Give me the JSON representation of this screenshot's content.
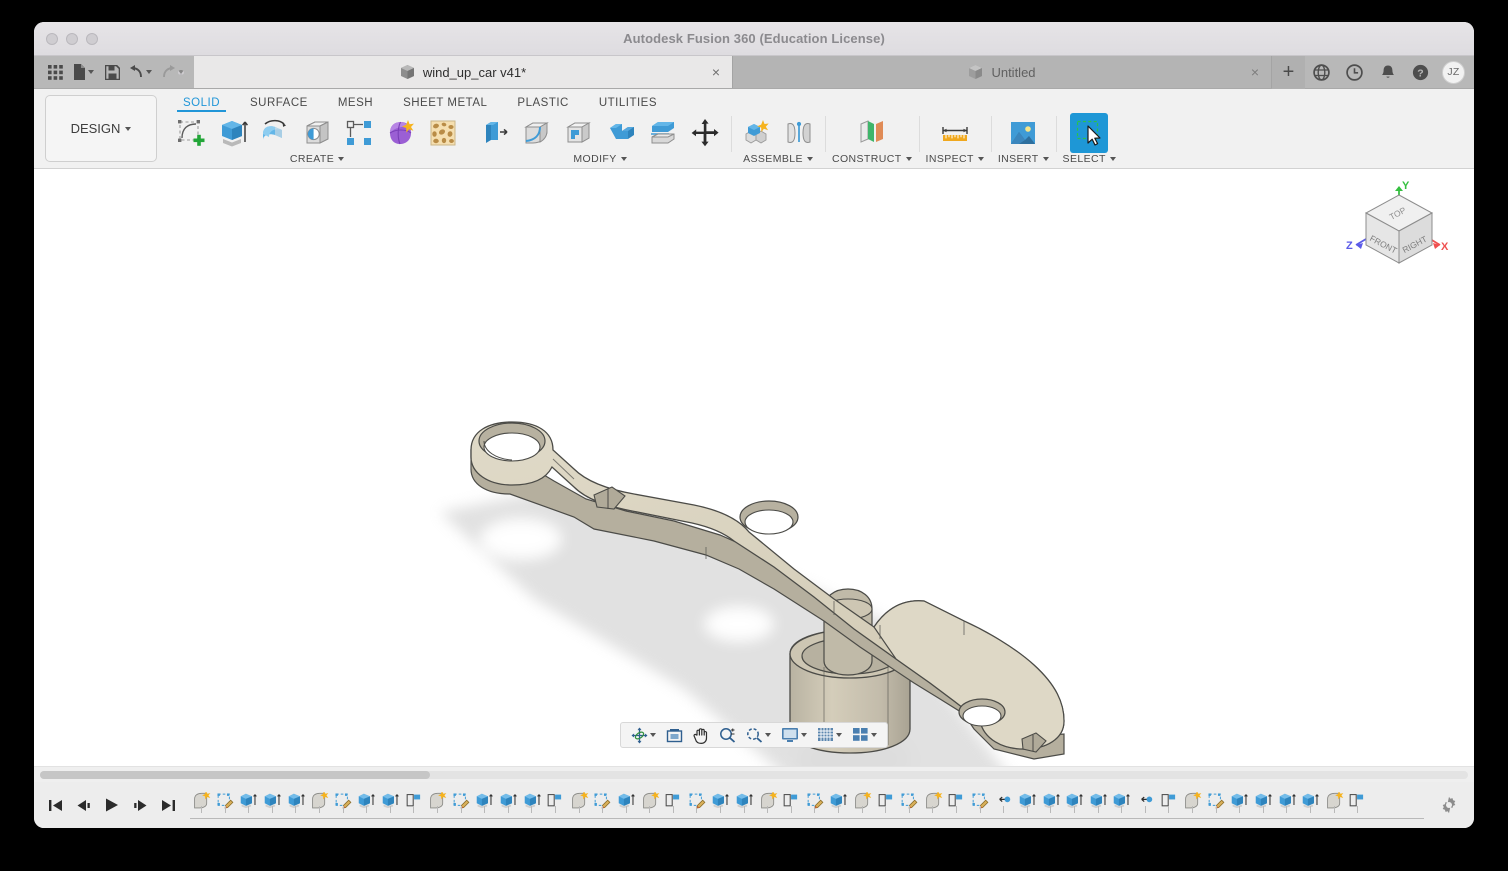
{
  "window": {
    "title": "Autodesk Fusion 360 (Education License)",
    "traffic_lights": [
      "close",
      "minimize",
      "maximize"
    ]
  },
  "quick_access": {
    "items": [
      {
        "name": "app-grid",
        "icon": "grid-icon",
        "caret": false
      },
      {
        "name": "new-file",
        "icon": "file-icon",
        "caret": true
      },
      {
        "name": "save",
        "icon": "save-icon",
        "caret": false
      },
      {
        "name": "undo",
        "icon": "undo-arrow-icon",
        "caret": true
      },
      {
        "name": "redo",
        "icon": "redo-arrow-icon",
        "caret": true
      }
    ]
  },
  "tabs": [
    {
      "label": "wind_up_car v41*",
      "active": true,
      "close": "×",
      "icon": "cube-icon"
    },
    {
      "label": "Untitled",
      "active": false,
      "close": "×",
      "icon": "cube-icon"
    }
  ],
  "titlebar_right": {
    "add_tab": "+",
    "items": [
      {
        "name": "globe-icon",
        "label": "globe"
      },
      {
        "name": "history-clock-icon",
        "label": "recent"
      },
      {
        "name": "bell-icon",
        "label": "notifications"
      },
      {
        "name": "help-icon",
        "label": "help"
      }
    ],
    "avatar_initials": "JZ"
  },
  "ribbon": {
    "workspace": "DESIGN",
    "workspace_caret": "▾",
    "tabs": [
      {
        "label": "SOLID",
        "active": true
      },
      {
        "label": "SURFACE",
        "active": false
      },
      {
        "label": "MESH",
        "active": false
      },
      {
        "label": "SHEET METAL",
        "active": false
      },
      {
        "label": "PLASTIC",
        "active": false
      },
      {
        "label": "UTILITIES",
        "active": false
      }
    ],
    "active_tab_color": "#2196d8",
    "panels": [
      {
        "label": "CREATE",
        "caret": "▾",
        "tools": [
          {
            "name": "create-sketch-icon",
            "title": "Create Sketch"
          },
          {
            "name": "extrude-icon",
            "title": "Extrude"
          },
          {
            "name": "revolve-icon",
            "title": "Revolve"
          },
          {
            "name": "hole-icon",
            "title": "Hole"
          },
          {
            "name": "pattern-icon",
            "title": "Rectangular Pattern"
          },
          {
            "name": "form-icon",
            "title": "Create Form"
          },
          {
            "name": "generative-design-icon",
            "title": "Generative Design"
          }
        ]
      },
      {
        "label": "MODIFY",
        "caret": "▾",
        "tools": [
          {
            "name": "press-pull-icon",
            "title": "Press Pull"
          },
          {
            "name": "fillet-icon",
            "title": "Fillet"
          },
          {
            "name": "shell-icon",
            "title": "Shell"
          },
          {
            "name": "combine-icon",
            "title": "Combine"
          },
          {
            "name": "split-face-icon",
            "title": "Split Face"
          },
          {
            "name": "move-copy-icon",
            "title": "Move/Copy"
          }
        ]
      },
      {
        "label": "ASSEMBLE",
        "caret": "▾",
        "tools": [
          {
            "name": "new-component-icon",
            "title": "New Component"
          },
          {
            "name": "joint-icon",
            "title": "Joint"
          }
        ]
      },
      {
        "label": "CONSTRUCT",
        "caret": "▾",
        "tools": [
          {
            "name": "offset-plane-icon",
            "title": "Offset Plane"
          }
        ]
      },
      {
        "label": "INSPECT",
        "caret": "▾",
        "tools": [
          {
            "name": "measure-icon",
            "title": "Measure"
          }
        ]
      },
      {
        "label": "INSERT",
        "caret": "▾",
        "tools": [
          {
            "name": "insert-image-icon",
            "title": "Decal"
          }
        ]
      },
      {
        "label": "SELECT",
        "caret": "▾",
        "selected": true,
        "tools": [
          {
            "name": "select-cursor-icon",
            "title": "Select",
            "active": true
          }
        ]
      }
    ]
  },
  "canvas": {
    "background": "#ffffff",
    "model": {
      "name": "wind-up-car-linkage-arm",
      "body_color": "#d6cfbb",
      "body_color_light": "#ded8c6",
      "body_color_dark": "#b3ad9c",
      "edge_color": "#4a4a46",
      "shadow_color": "#c9c9c9"
    },
    "viewcube": {
      "faces": [
        "TOP",
        "FRONT",
        "RIGHT"
      ],
      "axes": [
        {
          "label": "Y",
          "color": "#35c040"
        },
        {
          "label": "X",
          "color": "#ef5050"
        },
        {
          "label": "Z",
          "color": "#5a5ae8"
        }
      ]
    },
    "navbar": [
      {
        "name": "orbit-icon",
        "caret": true
      },
      {
        "name": "look-at-icon",
        "caret": false
      },
      {
        "name": "pan-icon",
        "caret": false
      },
      {
        "name": "zoom-icon",
        "caret": false
      },
      {
        "name": "zoom-window-icon",
        "caret": true
      },
      {
        "name": "display-settings-icon",
        "caret": true
      },
      {
        "name": "grid-snaps-icon",
        "caret": true
      },
      {
        "name": "viewports-icon",
        "caret": true
      }
    ]
  },
  "timeline": {
    "playback": [
      {
        "name": "go-to-beginning-button",
        "glyph": "jump-start"
      },
      {
        "name": "step-back-button",
        "glyph": "step-back"
      },
      {
        "name": "play-button",
        "glyph": "play"
      },
      {
        "name": "step-forward-button",
        "glyph": "step-forward"
      },
      {
        "name": "go-to-end-button",
        "glyph": "jump-end"
      }
    ],
    "settings_icon": "gear-icon",
    "features": [
      "sketch-new",
      "sketch-edit",
      "extrude",
      "extrude",
      "extrude",
      "sketch-new",
      "sketch-edit",
      "extrude",
      "extrude",
      "plane",
      "sketch-new",
      "sketch-edit",
      "extrude",
      "extrude",
      "extrude",
      "plane",
      "sketch-new",
      "sketch-edit",
      "extrude",
      "sketch-new",
      "plane",
      "sketch-edit",
      "extrude",
      "extrude",
      "sketch-new",
      "plane",
      "sketch-edit",
      "extrude",
      "sketch-new",
      "plane",
      "sketch-edit",
      "sketch-new",
      "plane",
      "sketch-edit",
      "mirror",
      "extrude",
      "extrude",
      "extrude",
      "extrude",
      "extrude",
      "joint",
      "plane",
      "sketch-new",
      "sketch-edit",
      "extrude",
      "extrude",
      "extrude",
      "extrude",
      "sketch-new",
      "plane"
    ]
  }
}
